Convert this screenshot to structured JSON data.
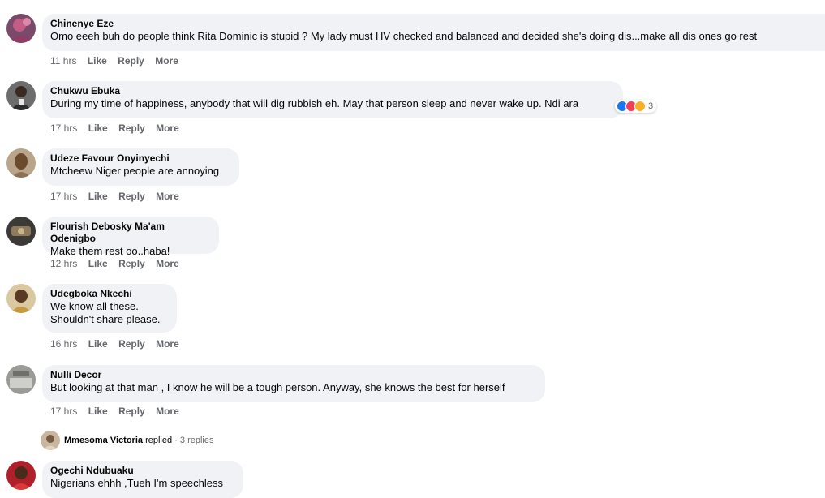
{
  "comments": [
    {
      "author": "Chinenye Eze",
      "text": "Omo eeeh buh do people think Rita Dominic is stupid ? My lady must HV checked and balanced and decided she's doing dis...make all dis ones go rest",
      "time": "11 hrs",
      "like": "Like",
      "reply": "Reply",
      "more": "More"
    },
    {
      "author": "Chukwu Ebuka",
      "text": "During my time of happiness, anybody that will dig rubbish eh. May that person sleep and never wake up. Ndi ara",
      "time": "17 hrs",
      "like": "Like",
      "reply": "Reply",
      "more": "More",
      "reactions": {
        "count": "3",
        "icons": [
          "like-reaction-icon",
          "love-reaction-icon",
          "care-reaction-icon"
        ]
      }
    },
    {
      "author": "Udeze Favour Onyinyechi",
      "text": "Mtcheew Niger people are annoying",
      "time": "17 hrs",
      "like": "Like",
      "reply": "Reply",
      "more": "More"
    },
    {
      "author": "Flourish Debosky Ma'am Odenigbo",
      "text": "Make them rest oo..haba!",
      "time": "12 hrs",
      "like": "Like",
      "reply": "Reply",
      "more": "More"
    },
    {
      "author": "Udegboka Nkechi",
      "text_lines": [
        "We know all these.",
        "Shouldn't share please."
      ],
      "time": "16 hrs",
      "like": "Like",
      "reply": "Reply",
      "more": "More"
    },
    {
      "author": "Nulli Decor",
      "text": "But looking at that man , I know he will be a tough person. Anyway, she knows the best for herself",
      "time": "17 hrs",
      "like": "Like",
      "reply": "Reply",
      "more": "More",
      "replies_summary": {
        "name": "Mmesoma Victoria",
        "action": "replied",
        "separator": "·",
        "count": "3 replies"
      }
    },
    {
      "author": "Ogechi Ndubuaku",
      "text": "Nigerians ehhh ,Tueh I'm speechless"
    }
  ],
  "colors": {
    "bubble": "#f0f2f5",
    "meta_text": "#65676b",
    "like_blue": "#1877f2",
    "love_red": "#f33e58",
    "care_yellow": "#f7b125"
  }
}
